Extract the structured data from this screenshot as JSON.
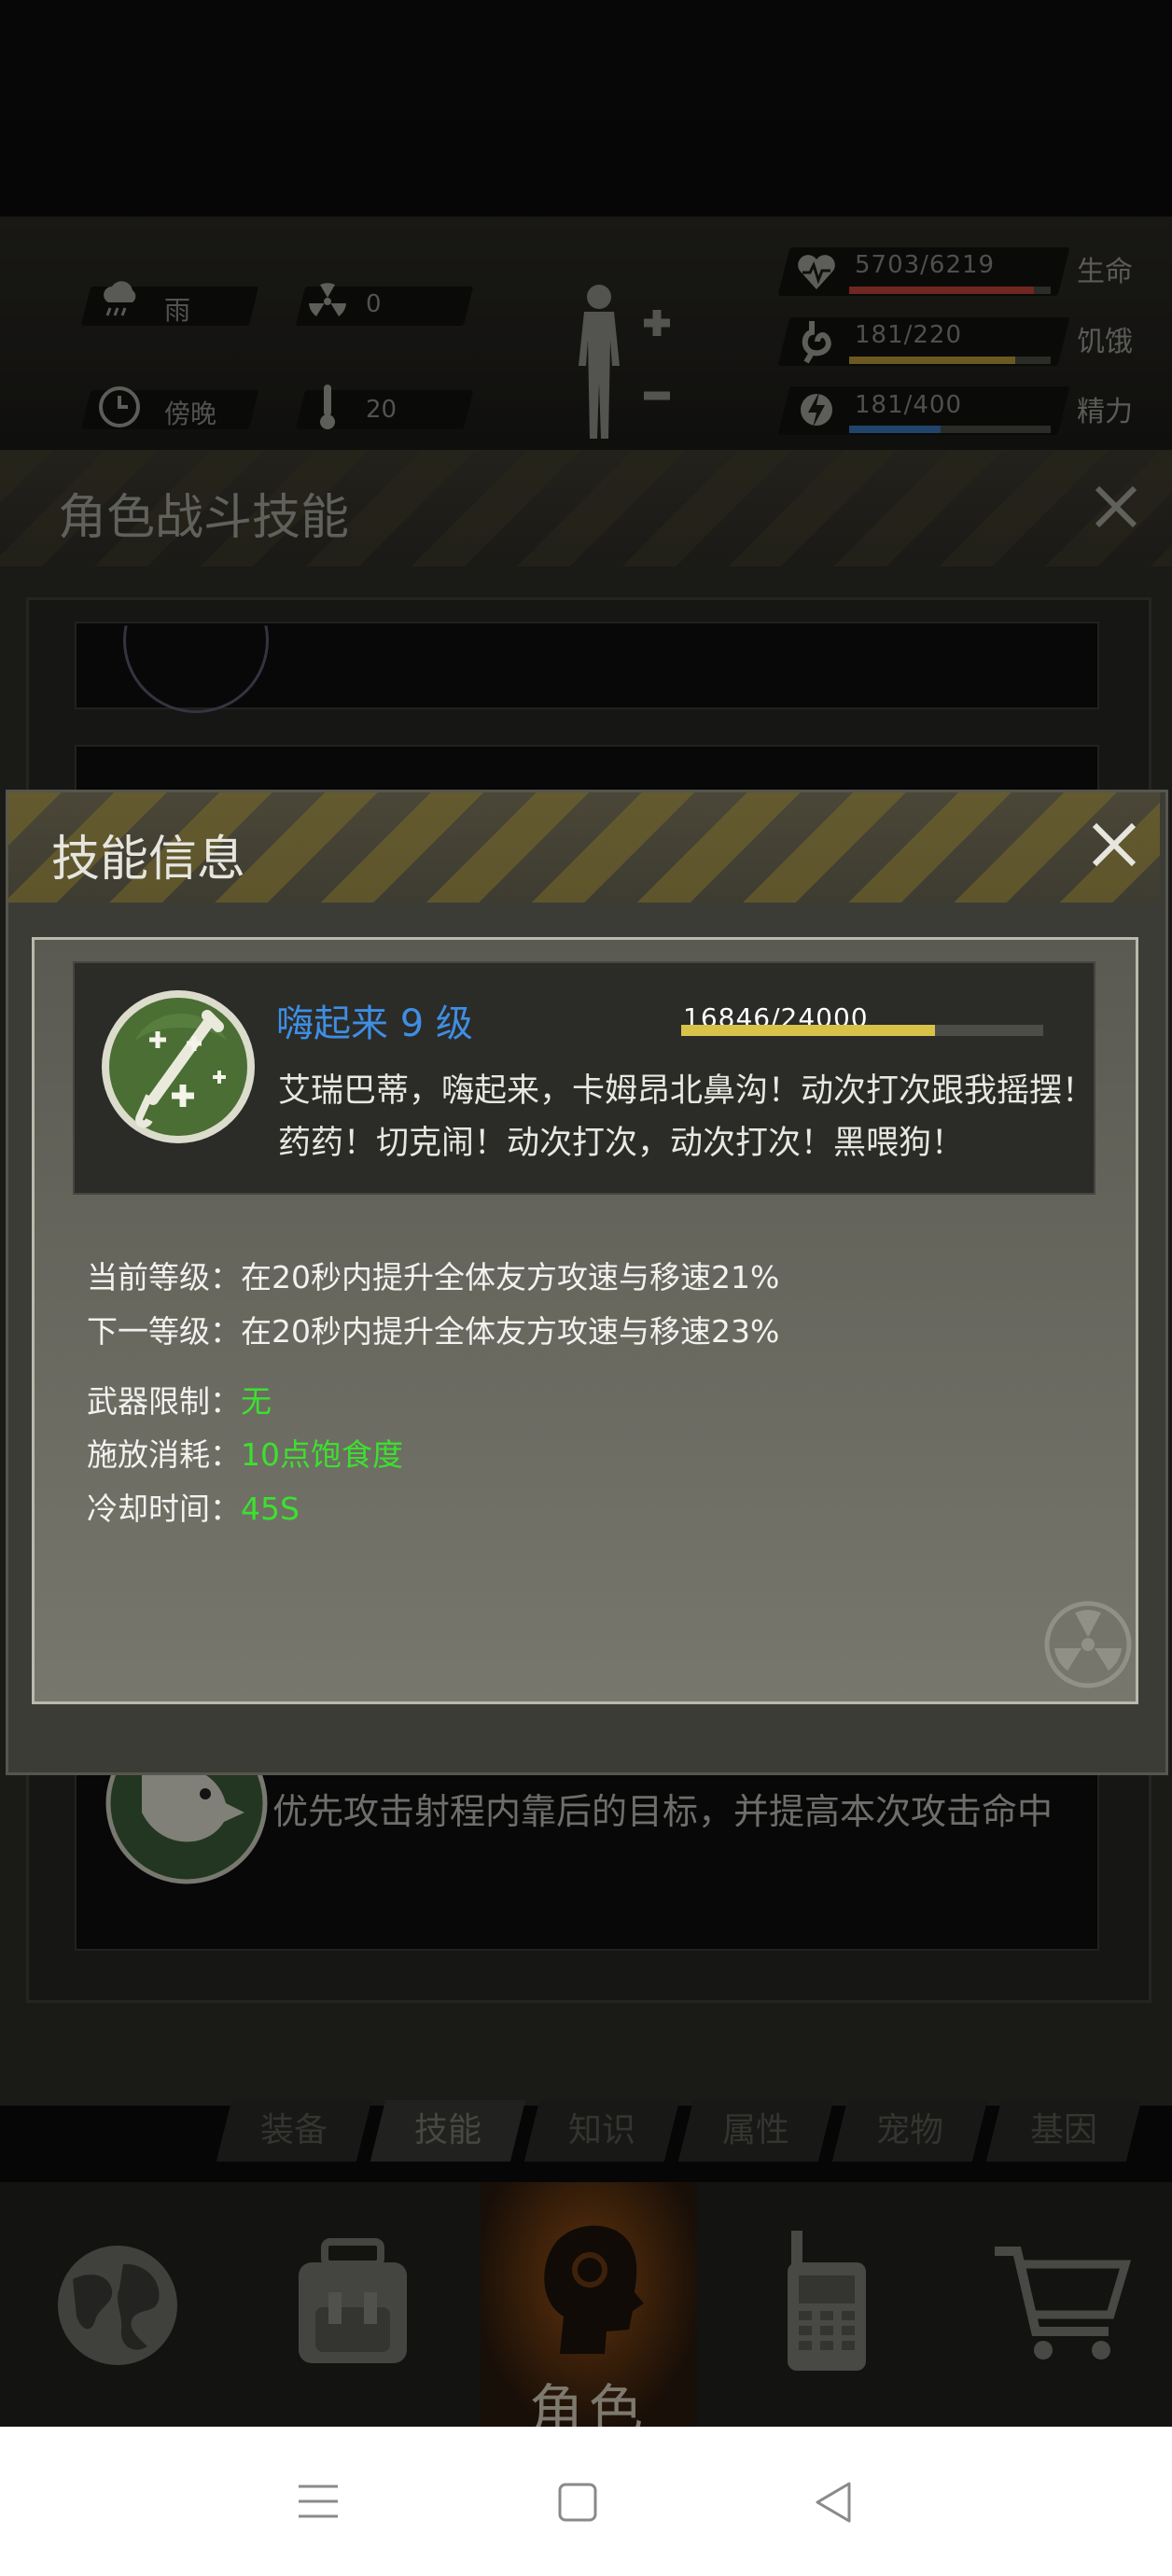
{
  "status": {
    "weather": "雨",
    "radiation": "0",
    "time_of_day": "傍晚",
    "temperature": "20",
    "health": {
      "value": "5703/6219",
      "label": "生命",
      "level": 0.917,
      "color": "#c2423a"
    },
    "hunger": {
      "value": "181/220",
      "label": "饥饿",
      "level": 0.823,
      "color": "#b99a3a"
    },
    "energy": {
      "value": "181/400",
      "label": "精力",
      "level": 0.453,
      "color": "#3a76b8"
    },
    "icons": [
      "rain-cloud-icon",
      "radiation-icon",
      "clock-icon",
      "thermometer-icon",
      "body-plus-minus-icon",
      "heart-pulse-icon",
      "stomach-icon",
      "lightning-icon"
    ]
  },
  "combat_panel": {
    "title": "角色战斗技能",
    "eagle_skill_text": "优先攻击射程内靠后的目标，并提高本次攻击命中"
  },
  "dialog": {
    "title": "技能信息",
    "skill": {
      "name": "嗨起来 9 级",
      "xp": "16846/24000",
      "xp_ratio": 0.702,
      "description_line1": "艾瑞巴蒂，嗨起来，卡姆昂北鼻沟！动次打次跟我摇摆！",
      "description_line2": "药药！切克闹！动次打次，动次打次！黑喂狗！"
    },
    "current_level_label": "当前等级：",
    "current_level_value": "在20秒内提升全体友方攻速与移速21%",
    "next_level_label": "下一等级：",
    "next_level_value": "在20秒内提升全体友方攻速与移速23%",
    "weapon_limit_label": "武器限制：",
    "weapon_limit_value": "无",
    "cost_label": "施放消耗：",
    "cost_value": "10点饱食度",
    "cooldown_label": "冷却时间：",
    "cooldown_value": "45S"
  },
  "subtabs": [
    "装备",
    "技能",
    "知识",
    "属性",
    "宠物",
    "基因"
  ],
  "bottom_nav": {
    "role_label": "角色",
    "icons": [
      "globe-icon",
      "backpack-icon",
      "role-head-icon",
      "walkie-talkie-icon",
      "shopping-cart-icon"
    ]
  },
  "system_nav": {
    "icons": [
      "menu-icon",
      "home-icon",
      "back-icon"
    ]
  }
}
